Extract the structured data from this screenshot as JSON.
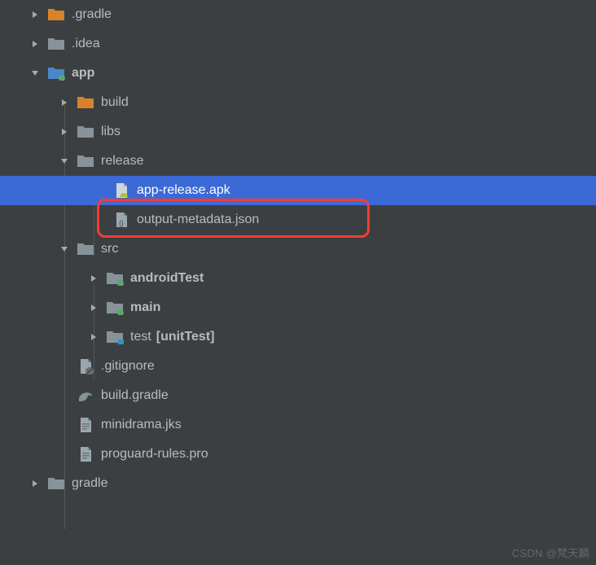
{
  "tree": {
    "gradle_hidden": ".gradle",
    "idea": ".idea",
    "app": "app",
    "build": "build",
    "libs": "libs",
    "release": "release",
    "app_release_apk": "app-release.apk",
    "output_metadata": "output-metadata.json",
    "src": "src",
    "android_test": "androidTest",
    "main": "main",
    "test": "test",
    "test_hint": "[unitTest]",
    "gitignore": ".gitignore",
    "build_gradle": "build.gradle",
    "minidrama_jks": "minidrama.jks",
    "proguard_rules": "proguard-rules.pro",
    "gradle_dir": "gradle"
  },
  "colors": {
    "folder_orange": "#d9822b",
    "folder_gray": "#87939a",
    "module_blue": "#4a88c7",
    "selection": "#3b6ad6",
    "dot_green": "#59a869",
    "dot_cyan": "#3592c4",
    "file_icon": "#9aa7b0",
    "android_green": "#a4c639"
  },
  "watermark": "CSDN @梵天麟"
}
